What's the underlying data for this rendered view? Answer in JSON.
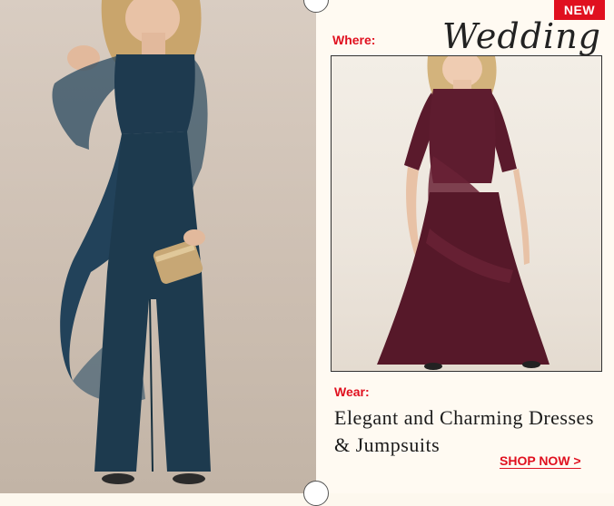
{
  "badge": {
    "label": "NEW"
  },
  "occasion": {
    "where_label": "Where:",
    "value": "Wedding"
  },
  "wear": {
    "label": "Wear:",
    "headline": "Elegant and Charming Dresses & Jumpsuits"
  },
  "cta": {
    "label": "SHOP NOW >"
  },
  "colors": {
    "accent": "#e0101f",
    "navy_jumpsuit": "#1e3a4f",
    "burgundy_dress": "#5a1a2c",
    "panel_bg": "#fffaf2"
  },
  "images": {
    "left": "model-in-navy-jumpsuit-with-clutch",
    "right": "model-in-burgundy-chiffon-dress"
  }
}
